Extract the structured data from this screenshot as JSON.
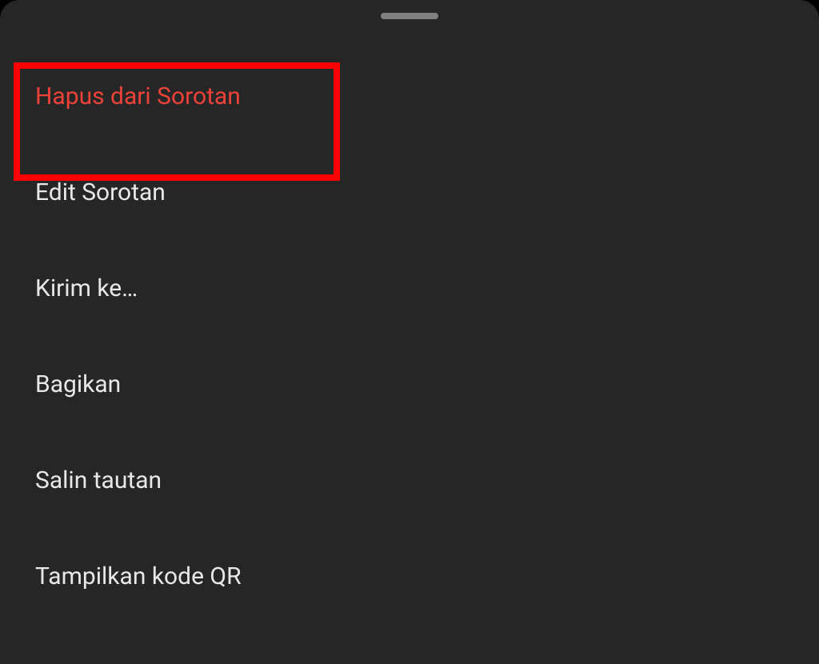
{
  "menu": {
    "items": [
      {
        "label": "Hapus dari Sorotan",
        "destructive": true
      },
      {
        "label": "Edit Sorotan",
        "destructive": false
      },
      {
        "label": "Kirim ke…",
        "destructive": false
      },
      {
        "label": "Bagikan",
        "destructive": false
      },
      {
        "label": "Salin tautan",
        "destructive": false
      },
      {
        "label": "Tampilkan kode QR",
        "destructive": false
      }
    ]
  },
  "annotation": {
    "highlight_color": "#ff0000"
  }
}
